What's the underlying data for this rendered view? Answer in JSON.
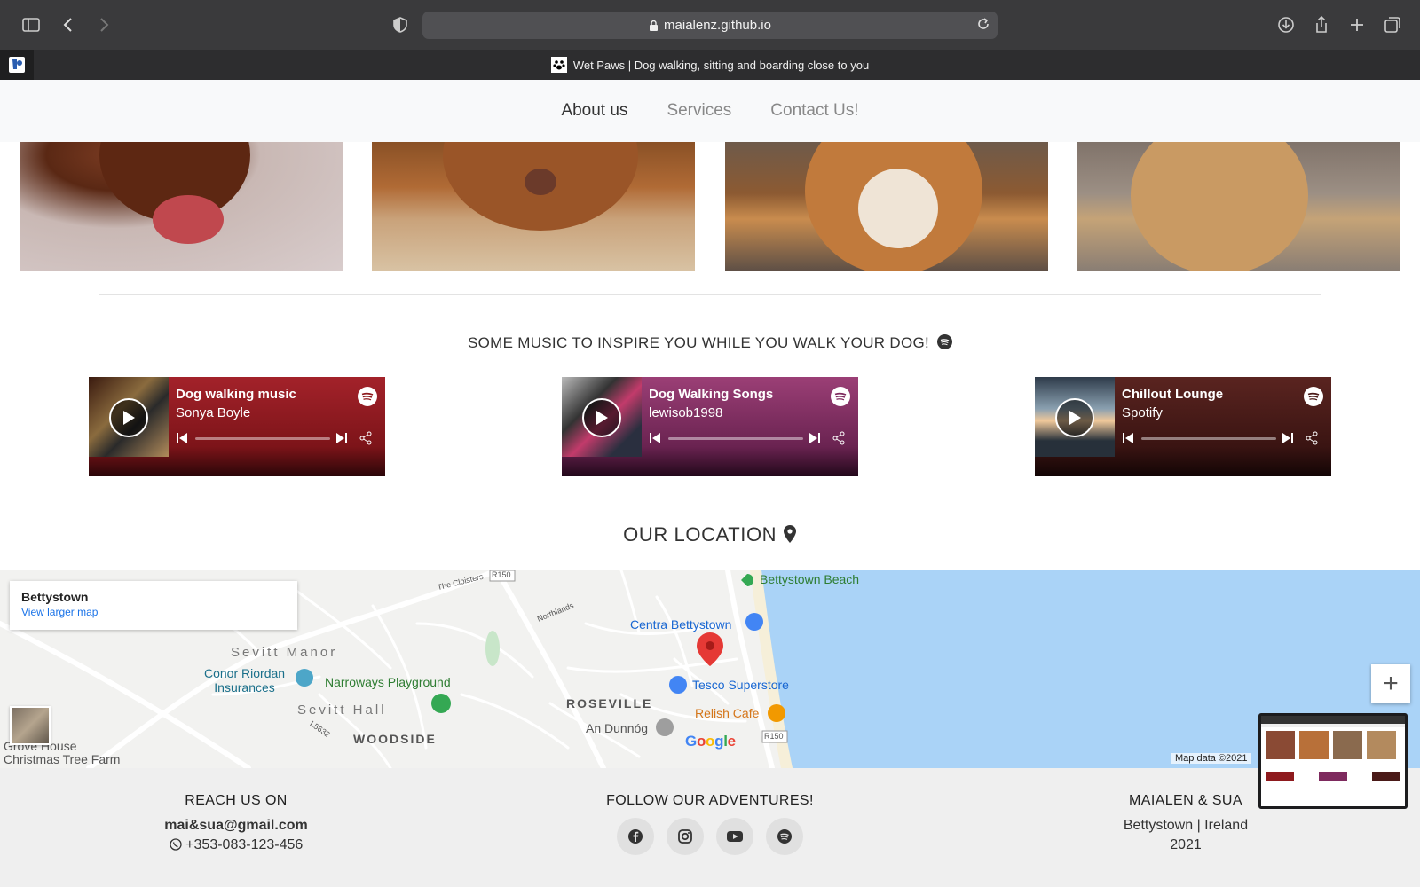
{
  "browser": {
    "url": "maialenz.github.io",
    "tab_title": "Wet Paws | Dog walking, sitting and boarding close to you"
  },
  "nav": {
    "items": [
      {
        "label": "About us",
        "active": true
      },
      {
        "label": "Services",
        "active": false
      },
      {
        "label": "Contact Us!",
        "active": false
      }
    ]
  },
  "music": {
    "heading": "SOME MUSIC TO INSPIRE YOU WHILE YOU WALK YOUR DOG!",
    "playlists": [
      {
        "title": "Dog walking music",
        "author": "Sonya Boyle",
        "color": "#8e1a1e"
      },
      {
        "title": "Dog Walking Songs",
        "author": "lewisob1998",
        "color": "#7e2a5e"
      },
      {
        "title": "Chillout Lounge",
        "author": "Spotify",
        "color": "#4a1a18"
      }
    ]
  },
  "location": {
    "heading": "OUR LOCATION",
    "map": {
      "place_name": "Bettystown",
      "larger_map_link": "View larger map",
      "attribution": "Map data ©2021",
      "google_logo": "Google",
      "labels": {
        "bettystown_beach": "Bettystown Beach",
        "centra": "Centra Bettystown",
        "tesco": "Tesco Superstore",
        "relish": "Relish Cafe",
        "an_dunnog": "An Dunnóg",
        "roseville": "ROSEVILLE",
        "woodside": "WOODSIDE",
        "sevitt_manor": "Sevitt Manor",
        "sevitt_hall": "Sevitt Hall",
        "conor_riordan": "Conor Riordan\nInsurances",
        "narroways": "Narroways Playground",
        "grove_house": "Grove House",
        "christmas_tree": "Christmas Tree Farm",
        "the_cloisters": "The Cloisters",
        "northlands": "Northlands",
        "r150_top": "R150",
        "r150_bottom": "R150",
        "l5632": "L5632"
      }
    }
  },
  "footer": {
    "reach": {
      "heading": "REACH US ON",
      "email": "mai&sua@gmail.com",
      "phone": "+353-083-123-456"
    },
    "follow": {
      "heading": "FOLLOW OUR ADVENTURES!",
      "icons": [
        "facebook-icon",
        "instagram-icon",
        "youtube-icon",
        "spotify-icon"
      ]
    },
    "owners": {
      "heading": "MAIALEN & SUA",
      "place": "Bettystown | Ireland",
      "year": "2021"
    }
  },
  "colors": {
    "chrome": "#3a3a3c",
    "tabbar": "#2d2d2f",
    "nav_bg": "#f8f9fa",
    "sea": "#aad3f7",
    "map_land": "#f2f2f0",
    "footer_bg": "#efefef",
    "marker_red": "#e53935",
    "link_blue": "#1a73e8"
  }
}
